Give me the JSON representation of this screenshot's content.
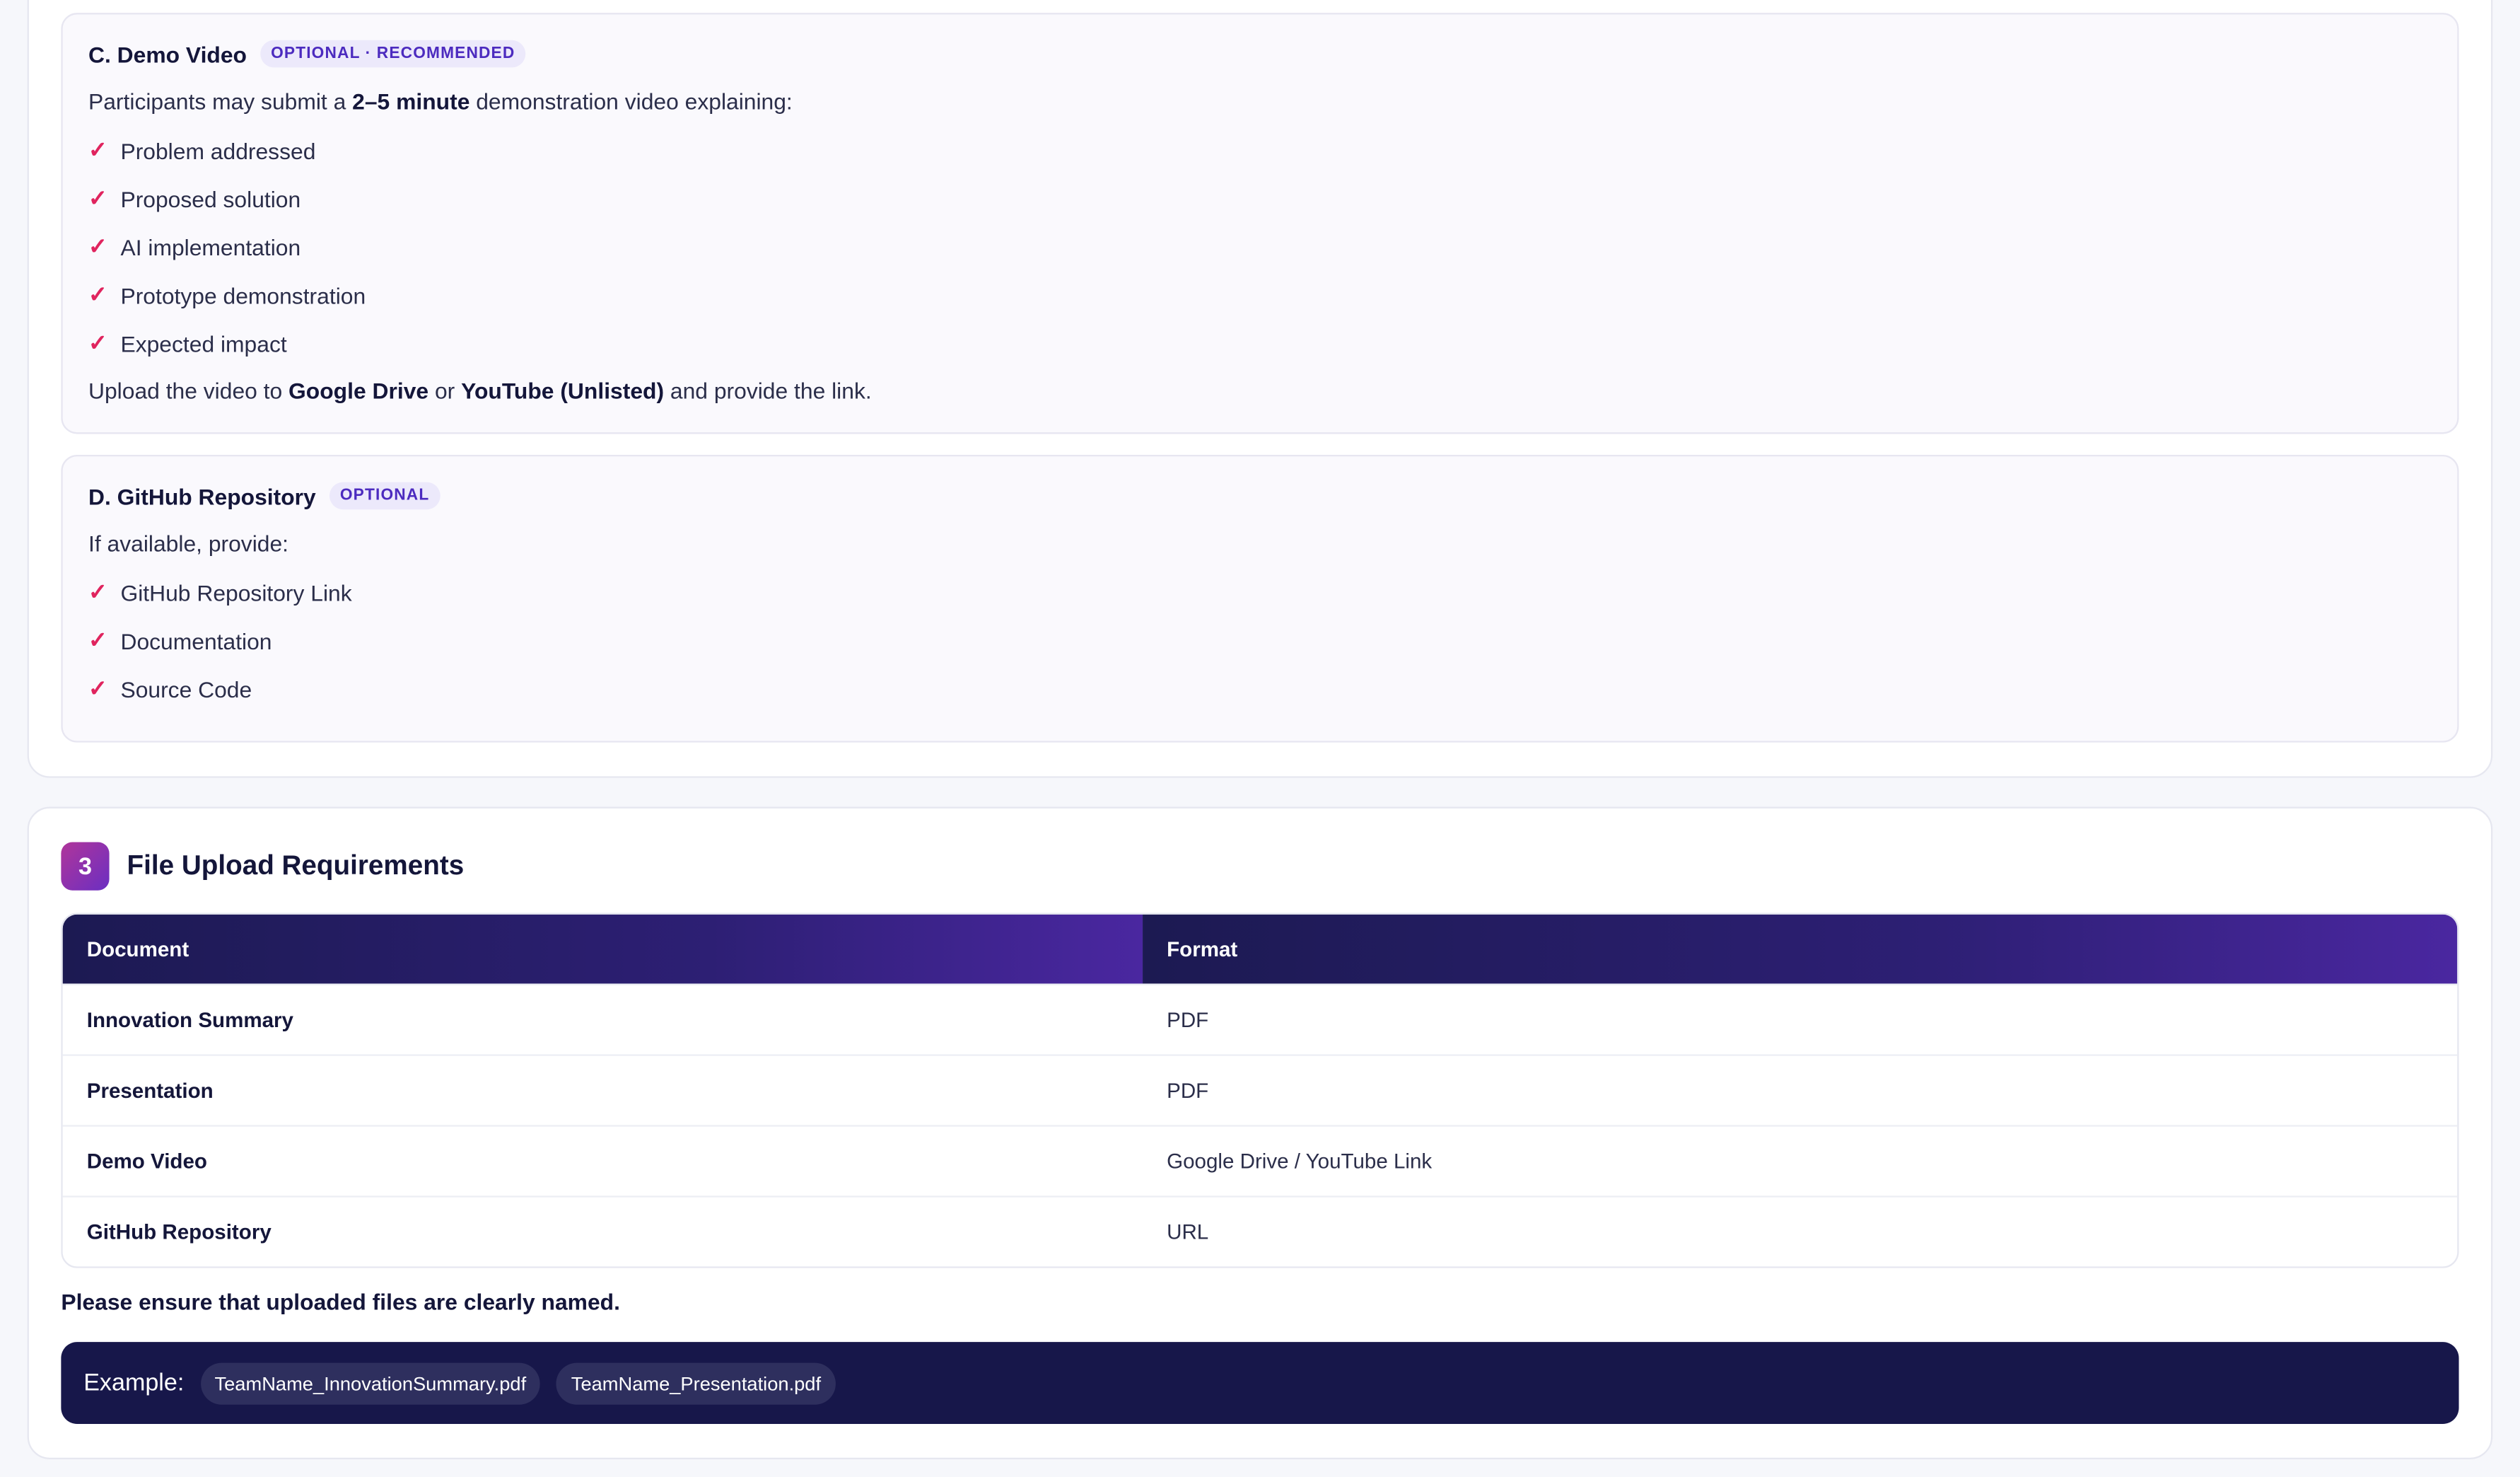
{
  "section_c": {
    "title": "C. Demo Video",
    "badge": "OPTIONAL · RECOMMENDED",
    "intro_pre": "Participants may submit a ",
    "intro_bold": "2–5 minute",
    "intro_post": " demonstration video explaining:",
    "items": [
      "Problem addressed",
      "Proposed solution",
      "AI implementation",
      "Prototype demonstration",
      "Expected impact"
    ],
    "upload_pre": "Upload the video to ",
    "upload_bold1": "Google Drive",
    "upload_mid": " or ",
    "upload_bold2": "YouTube (Unlisted)",
    "upload_post": " and provide the link."
  },
  "section_d": {
    "title": "D. GitHub Repository",
    "badge": "OPTIONAL",
    "intro": "If available, provide:",
    "items": [
      "GitHub Repository Link",
      "Documentation",
      "Source Code"
    ]
  },
  "check_glyph": "✓",
  "section3": {
    "number": "3",
    "title": "File Upload Requirements",
    "table": {
      "headers": [
        "Document",
        "Format"
      ],
      "rows": [
        [
          "Innovation Summary",
          "PDF"
        ],
        [
          "Presentation",
          "PDF"
        ],
        [
          "Demo Video",
          "Google Drive / YouTube Link"
        ],
        [
          "GitHub Repository",
          "URL"
        ]
      ]
    },
    "note": "Please ensure that uploaded files are clearly named.",
    "example_label": "Example:",
    "example_chips": [
      "TeamName_InnovationSummary.pdf",
      "TeamName_Presentation.pdf"
    ]
  },
  "colors": {
    "accent": "#e0245e",
    "badge_text": "#4c2bbf",
    "navy": "#17174a"
  }
}
